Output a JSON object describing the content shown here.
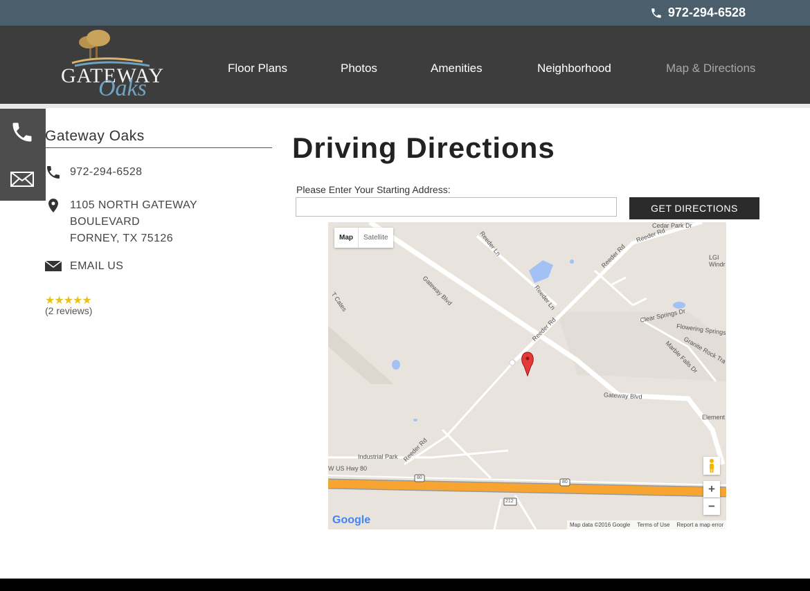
{
  "header": {
    "phone": "972-294-6528",
    "logo_line1": "GATEWAY",
    "logo_line2": "Oaks"
  },
  "nav": {
    "items": [
      {
        "label": "Floor Plans"
      },
      {
        "label": "Photos"
      },
      {
        "label": "Amenities"
      },
      {
        "label": "Neighborhood"
      },
      {
        "label": "Map & Directions"
      }
    ]
  },
  "sidebar": {
    "title": "Gateway Oaks",
    "phone": "972-294-6528",
    "address_line1": "1105 NORTH GATEWAY",
    "address_line2": "BOULEVARD",
    "address_line3": "FORNEY, TX 75126",
    "email_label": "EMAIL US",
    "stars": "★★★★★",
    "reviews": "(2 reviews)"
  },
  "main": {
    "heading": "Driving Directions",
    "address_label": "Please Enter Your Starting Address:",
    "address_value": "",
    "address_placeholder": "",
    "button_label": "GET DIRECTIONS"
  },
  "map": {
    "toggle_map": "Map",
    "toggle_satellite": "Satellite",
    "labels": {
      "cedar_park": "Cedar Park Dr",
      "reeder_rd_top": "Reeder Rd",
      "reeder_ln_top": "Reeder Ln",
      "lgi": "LGI",
      "windr": "Windr",
      "gateway_blvd_diag": "Gateway Blvd",
      "reeder_rd_mid": "Reeder Rd",
      "reeder_ln_mid": "Reeder Ln",
      "reeder_rd_right": "Reeder Rd",
      "t_cates": "T Cates",
      "clear_springs": "Clear Springs Dr",
      "flowering_springs": "Flowering Springs",
      "granite_rock": "Granite Rock Tra",
      "marble_falls": "Marble Falls Dr",
      "gateway_blvd_h": "Gateway Blvd",
      "element": "Element",
      "industrial_park": "Industrial Park",
      "reeder_rd_low": "Reeder Rd",
      "us_hwy_80": "W US Hwy 80",
      "shield_80_a": "80",
      "shield_80_b": "80",
      "shield_212": "212"
    },
    "zoom_in": "+",
    "zoom_out": "−",
    "google": "Google",
    "attrib_data": "Map data ©2016 Google",
    "attrib_terms": "Terms of Use",
    "attrib_report": "Report a map error"
  },
  "colors": {
    "topbar": "#4a5e6b",
    "navbar": "#3d3d3d",
    "button": "#2b2b2b",
    "highway": "#f7a530",
    "water": "#a3c1f5"
  }
}
